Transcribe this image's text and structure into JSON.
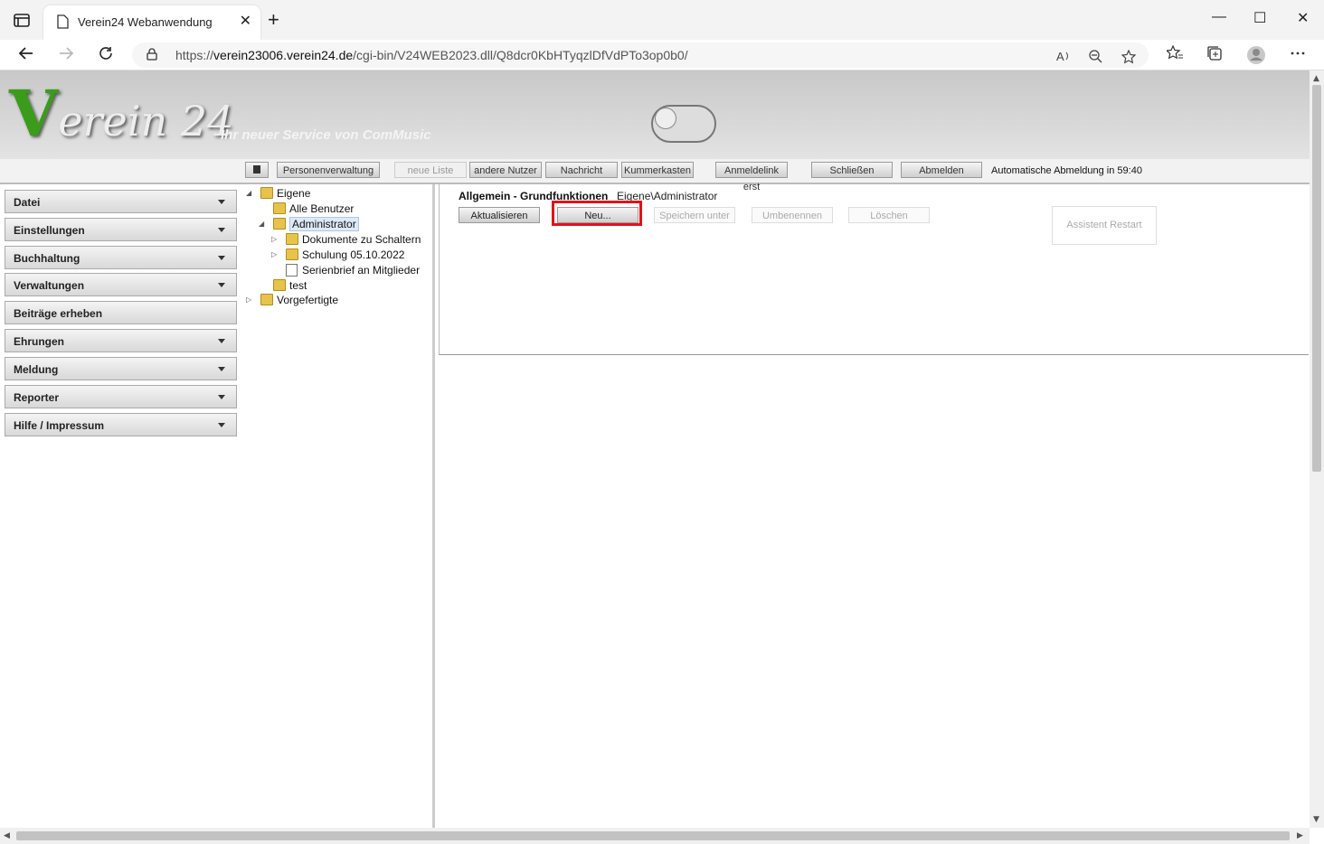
{
  "browser": {
    "tab_title": "Verein24 Webanwendung",
    "tab_close": "✕",
    "new_tab": "+",
    "window_controls": {
      "minimize": "—",
      "maximize": "☐",
      "close": "✕"
    },
    "url_scheme": "https://",
    "url_host": "verein23006.verein24.de",
    "url_path": "/cgi-bin/V24WEB2023.dll/Q8dcr0KbHTyqzlDfVdPTo3op0b0/"
  },
  "header": {
    "logo_v": "V",
    "logo_text": "erein 24",
    "slogan": "Ihr neuer Service von ComMusic"
  },
  "toolbar": {
    "buttons": [
      {
        "label": "Personenverwaltung",
        "disabled": false
      },
      {
        "label": "neue Liste",
        "disabled": true
      },
      {
        "label": "andere Nutzer",
        "disabled": false
      },
      {
        "label": "Nachricht",
        "disabled": false
      },
      {
        "label": "Kummerkasten",
        "disabled": false
      },
      {
        "label": "Anmeldelink erst",
        "disabled": false
      },
      {
        "label": "Schließen",
        "disabled": false
      },
      {
        "label": "Abmelden",
        "disabled": false
      }
    ],
    "auto_logout": "Automatische Abmeldung in 59:40"
  },
  "menu": {
    "items": [
      {
        "label": "Datei",
        "has_dropdown": true
      },
      {
        "label": "Einstellungen",
        "has_dropdown": true
      },
      {
        "label": "Buchhaltung",
        "has_dropdown": true
      },
      {
        "label": "Verwaltungen",
        "has_dropdown": true
      },
      {
        "label": "Beiträge erheben",
        "has_dropdown": false
      },
      {
        "label": "Ehrungen",
        "has_dropdown": true
      },
      {
        "label": "Meldung",
        "has_dropdown": true
      },
      {
        "label": "Reporter",
        "has_dropdown": true
      },
      {
        "label": "Hilfe / Impressum",
        "has_dropdown": true
      }
    ]
  },
  "tree": {
    "nodes": [
      {
        "label": "Eigene",
        "expander": "◢",
        "icon": "folder-icon"
      },
      {
        "label": "Alle Benutzer",
        "expander": "",
        "icon": "folder-icon"
      },
      {
        "label": "Administrator",
        "expander": "◢",
        "icon": "folder-icon",
        "selected": true
      },
      {
        "label": "Dokumente zu Schaltern",
        "expander": "▷",
        "icon": "folder-icon"
      },
      {
        "label": "Schulung 05.10.2022",
        "expander": "▷",
        "icon": "folder-icon"
      },
      {
        "label": "Serienbrief an Mitglieder",
        "expander": "",
        "icon": "document-icon"
      },
      {
        "label": "test",
        "expander": "",
        "icon": "folder-icon"
      },
      {
        "label": "Vorgefertigte",
        "expander": "▷",
        "icon": "folder-icon"
      }
    ]
  },
  "main": {
    "title": "Allgemein - Grundfunktionen",
    "path": "Eigene\\Administrator",
    "buttons": [
      {
        "label": "Aktualisieren",
        "disabled": false
      },
      {
        "label": "Neu...",
        "disabled": false,
        "highlighted": true
      },
      {
        "label": "Speichern unter",
        "disabled": true
      },
      {
        "label": "Umbenennen",
        "disabled": true
      },
      {
        "label": "Löschen",
        "disabled": true
      }
    ],
    "assistant": "Assistent Restart"
  },
  "colors": {
    "highlight": "#e3121b",
    "logo_green": "#3a9c1a"
  }
}
